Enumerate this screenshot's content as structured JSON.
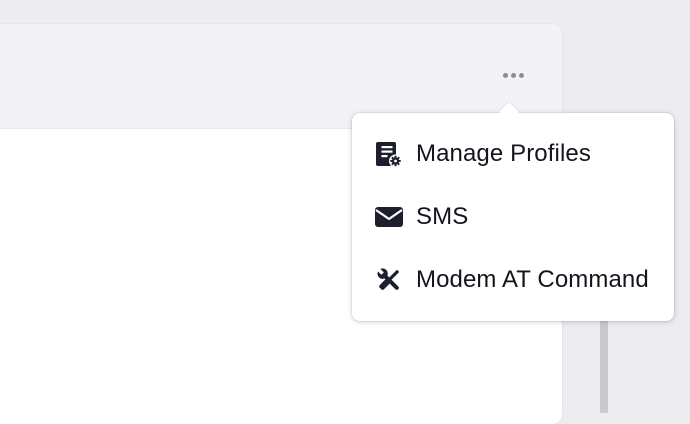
{
  "header": {
    "more_icon": "more-horizontal-icon"
  },
  "menu": {
    "items": [
      {
        "label": "Manage Profiles",
        "icon": "profile-settings-icon"
      },
      {
        "label": "SMS",
        "icon": "envelope-icon"
      },
      {
        "label": "Modem AT Command",
        "icon": "tools-icon"
      }
    ]
  },
  "colors": {
    "page_background": "#ececf1",
    "panel_header": "#f3f3f7",
    "panel_body": "#ffffff",
    "menu_text": "#14141c",
    "icon": "#1d1f2e",
    "dots": "#8e8e98"
  }
}
